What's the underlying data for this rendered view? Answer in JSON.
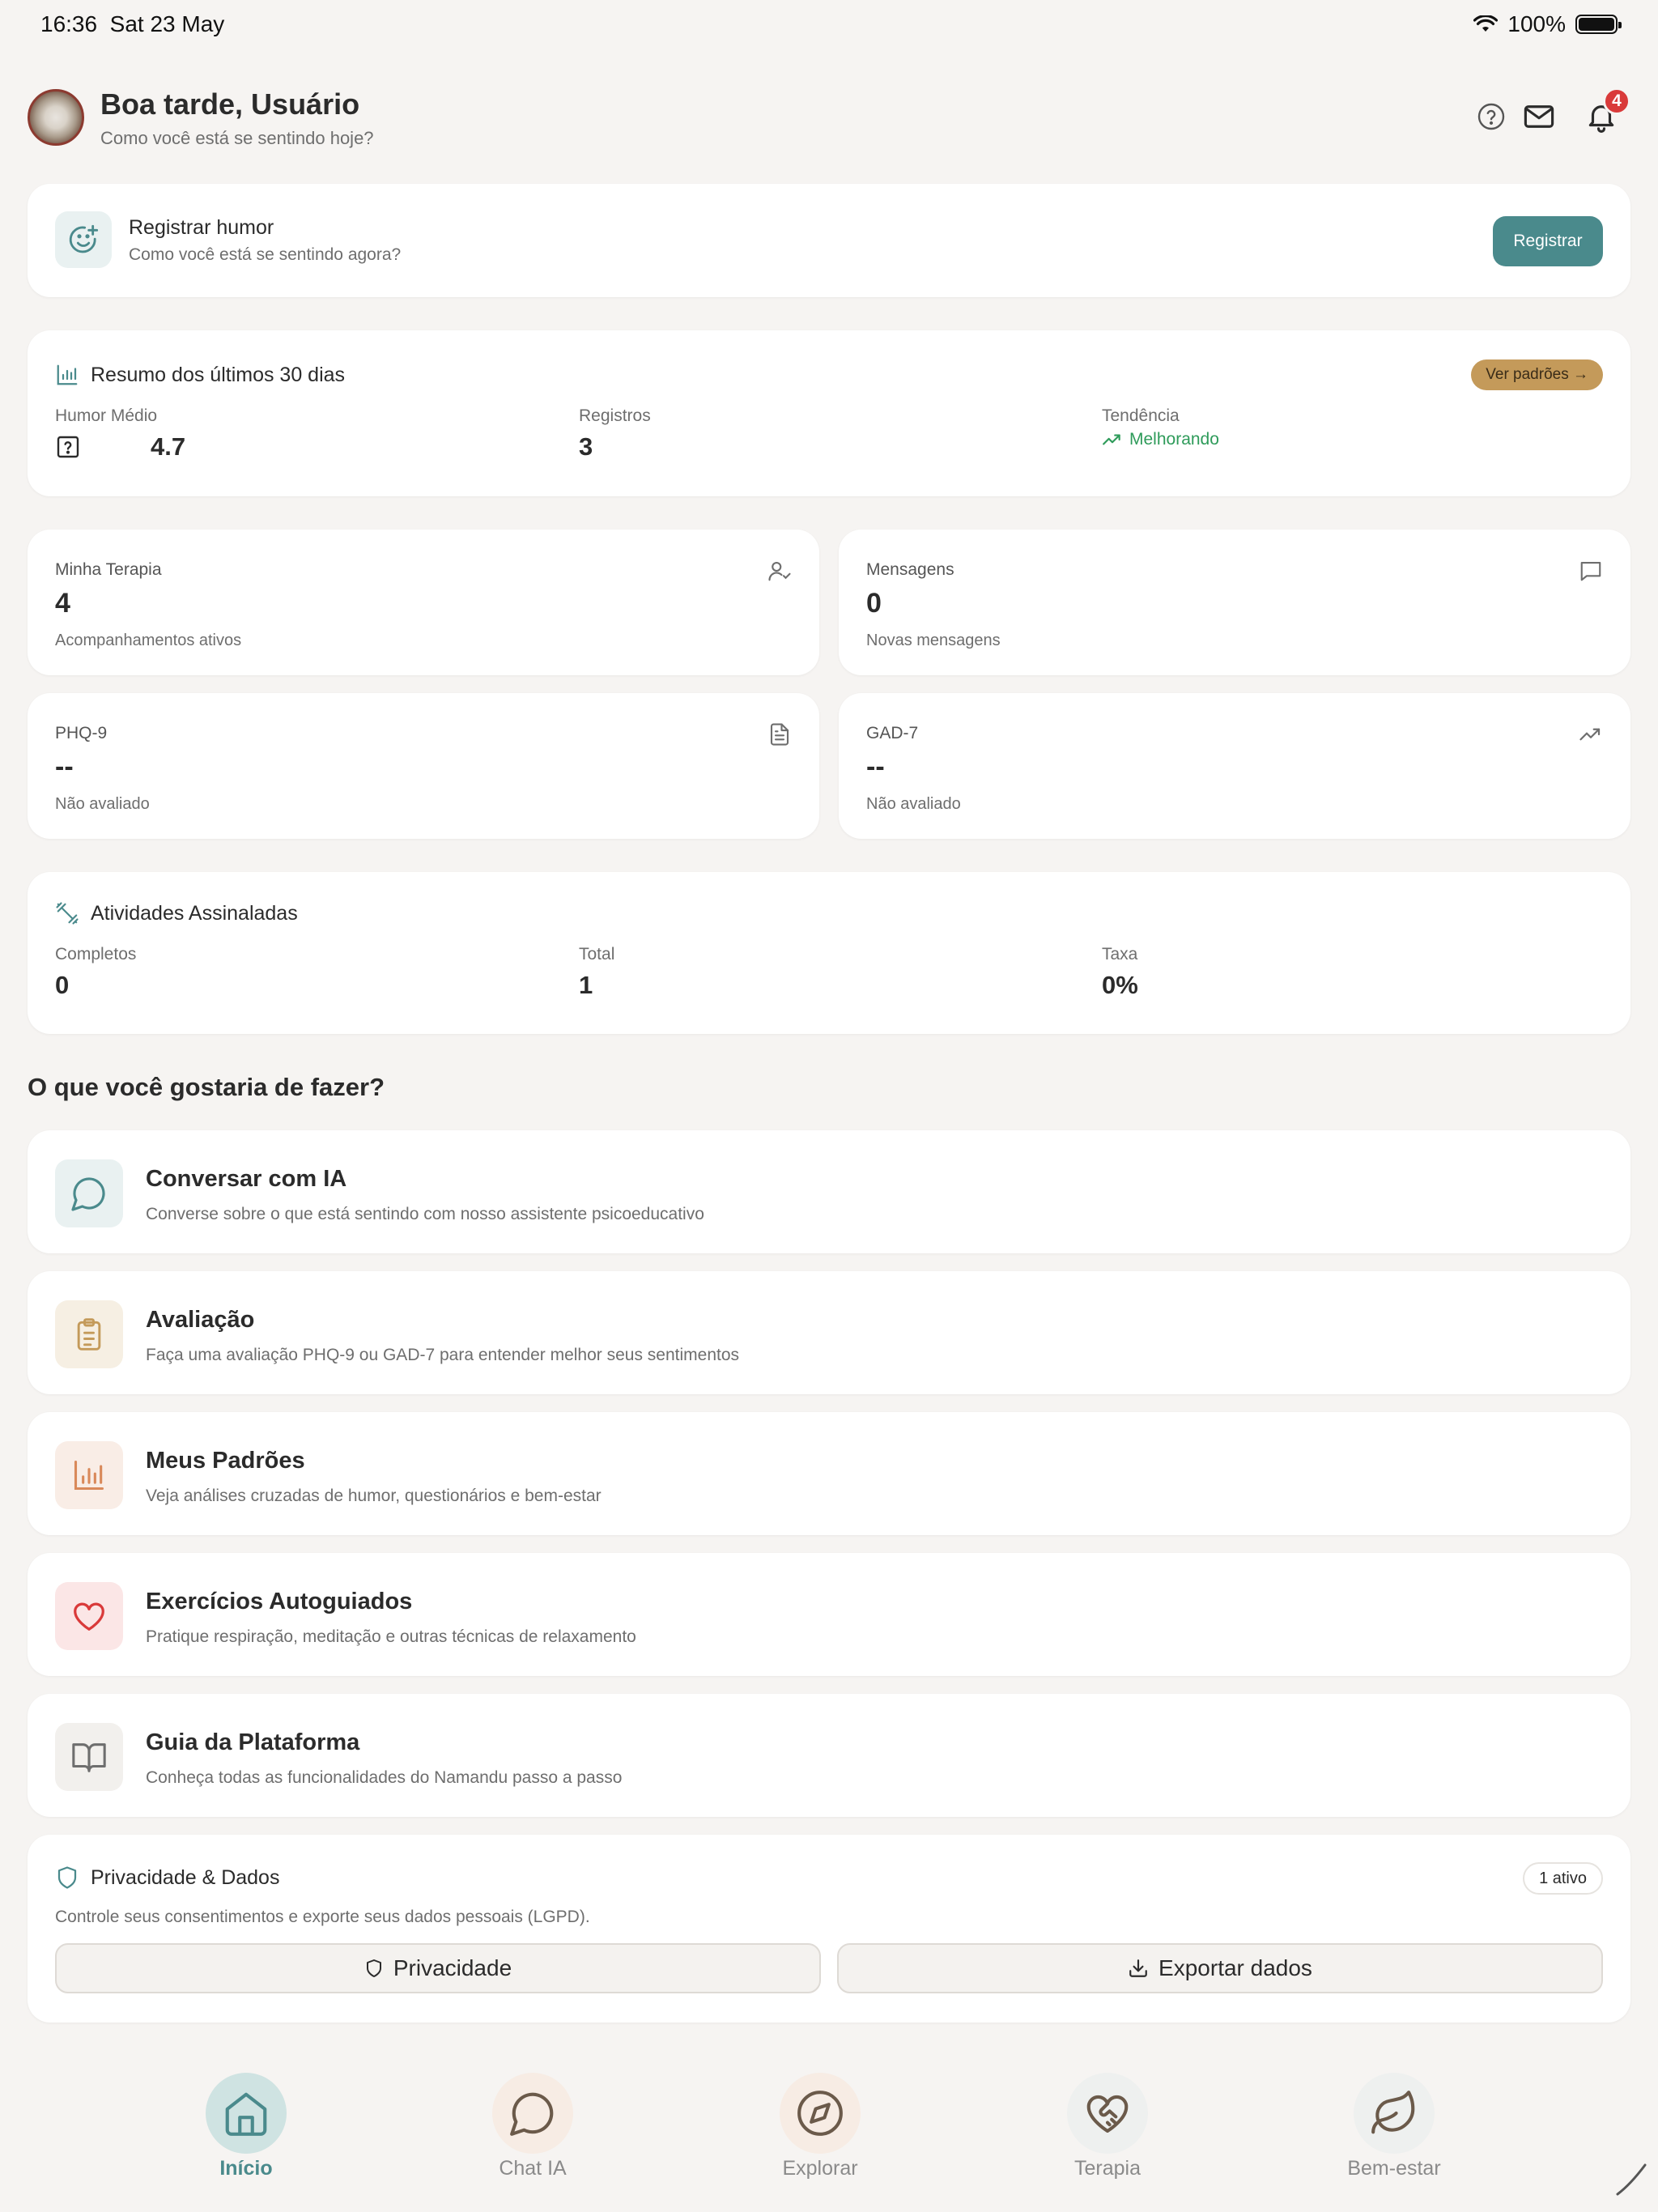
{
  "status_bar": {
    "time": "16:36",
    "date": "Sat 23 May",
    "battery": "100%"
  },
  "header": {
    "greeting": "Boa tarde, Usuário",
    "subtitle": "Como você está se sentindo hoje?",
    "notification_count": "4",
    "icons": [
      "help-icon",
      "mail-icon",
      "bell-icon"
    ]
  },
  "mood_card": {
    "title": "Registrar humor",
    "subtitle": "Como você está se sentindo agora?",
    "button": "Registrar"
  },
  "summary": {
    "title": "Resumo dos últimos 30 dias",
    "link": "Ver padrões →",
    "avg_label": "Humor Médio",
    "avg_value": "4.7",
    "records_label": "Registros",
    "records_value": "3",
    "trend_label": "Tendência",
    "trend_value": "Melhorando"
  },
  "stats": {
    "therapy": {
      "label": "Minha Terapia",
      "value": "4",
      "sub": "Acompanhamentos ativos",
      "icon": "user-check-icon"
    },
    "messages": {
      "label": "Mensagens",
      "value": "0",
      "sub": "Novas mensagens",
      "icon": "message-square-icon"
    },
    "phq9": {
      "label": "PHQ-9",
      "value": "--",
      "sub": "Não avaliado",
      "icon": "file-text-icon"
    },
    "gad7": {
      "label": "GAD-7",
      "value": "--",
      "sub": "Não avaliado",
      "icon": "trending-up-icon"
    }
  },
  "activities": {
    "title": "Atividades Assinaladas",
    "completed_label": "Completos",
    "completed_value": "0",
    "total_label": "Total",
    "total_value": "1",
    "rate_label": "Taxa",
    "rate_value": "0%"
  },
  "section_title": "O que você gostaria de fazer?",
  "actions": [
    {
      "title": "Conversar com IA",
      "subtitle": "Converse sobre o que está sentindo com nosso assistente psicoeducativo",
      "icon": "chat-bubble-icon",
      "bg": "#e9f1f1",
      "color": "#4a8a8c"
    },
    {
      "title": "Avaliação",
      "subtitle": "Faça uma avaliação PHQ-9 ou GAD-7 para entender melhor seus sentimentos",
      "icon": "clipboard-icon",
      "bg": "#f6efe3",
      "color": "#c49a5a"
    },
    {
      "title": "Meus Padrões",
      "subtitle": "Veja análises cruzadas de humor, questionários e bem-estar",
      "icon": "bar-chart-icon",
      "bg": "#f9ede6",
      "color": "#d9895a"
    },
    {
      "title": "Exercícios Autoguiados",
      "subtitle": "Pratique respiração, meditação e outras técnicas de relaxamento",
      "icon": "heart-icon",
      "bg": "#fbe6e6",
      "color": "#d93a3a"
    },
    {
      "title": "Guia da Plataforma",
      "subtitle": "Conheça todas as funcionalidades do Namandu passo a passo",
      "icon": "book-open-icon",
      "bg": "#f2f0ed",
      "color": "#6e6e6e"
    }
  ],
  "privacy": {
    "title": "Privacidade & Dados",
    "badge": "1 ativo",
    "subtitle": "Controle seus consentimentos e exporte seus dados pessoais (LGPD).",
    "privacy_button": "Privacidade",
    "export_button": "Exportar dados"
  },
  "nav": [
    {
      "label": "Início",
      "icon": "home-icon",
      "active": true
    },
    {
      "label": "Chat IA",
      "icon": "chat-bubble-icon",
      "active": false
    },
    {
      "label": "Explorar",
      "icon": "compass-icon",
      "active": false
    },
    {
      "label": "Terapia",
      "icon": "heart-handshake-icon",
      "active": false
    },
    {
      "label": "Bem-estar",
      "icon": "leaf-icon",
      "active": false
    }
  ],
  "colors": {
    "accent": "#4a8a8c",
    "gold": "#c49a5a",
    "success": "#2e9b5a",
    "danger": "#d93a3a",
    "background": "#f6f4f2"
  }
}
